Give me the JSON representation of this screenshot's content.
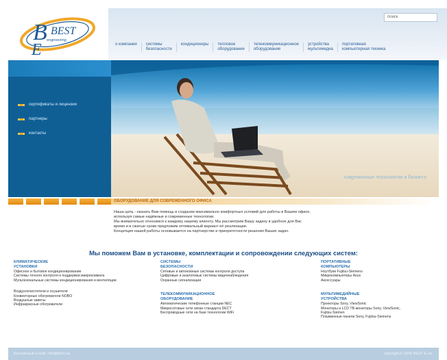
{
  "logo": {
    "text_top": "BEST",
    "text_sub": "engineering"
  },
  "search": {
    "placeholder": "поиск"
  },
  "nav": [
    {
      "label": "о компании"
    },
    {
      "label": "системы\nбезопасности"
    },
    {
      "label": "кондиционеры"
    },
    {
      "label": "тепловое\nоборудование"
    },
    {
      "label": "телекоммуникационное\nоборудование"
    },
    {
      "label": "устройства\nмультимедиа"
    },
    {
      "label": "портативная\nкомпьютерная техника"
    }
  ],
  "left_menu": [
    {
      "label": "сертификаты и лицензии"
    },
    {
      "label": "партнеры"
    },
    {
      "label": "контакты"
    }
  ],
  "hero": {
    "caption": "современные технологии в бизнесе"
  },
  "section": {
    "title": "ОБОРУДОВАНИЕ ДЛЯ СОВРЕМЕННОГО ОФИСА"
  },
  "intro": [
    "Наша цель - оказать Вам помощь в создании максимально комфортных условий для работы в Вашем офисе,",
    "используя самые надёжные и современные технологии.",
    "Мы внимательно относимся к каждому нашему клиенту. Мы рассмотрим Вашу задачу в удобное для Вас",
    "время и в сжатые сроки предложим оптимальный вариант её реализации.",
    "Концепция нашей работы основывается на партнерстве и приоритетности решения Ваших задач."
  ],
  "headline": "Мы поможем Вам в установке, комплектации и сопровождении следующих систем:",
  "columns": [
    {
      "blocks": [
        {
          "title": "КЛИМАТИЧЕСКИЕ\nУСТАНОВКИ",
          "items": [
            "Офисное и бытовое кондиционирование",
            "Системы точного контроля и поддержки микроклимата",
            "Мультизональные системы кондиционирования и вентиляции"
          ]
        },
        {
          "title": "",
          "items": [
            "Воздухоочистители и осушители",
            "Конвекторные обогреватели NOBO",
            "Воздушные завесы",
            "Инфракрасные обогреватели"
          ]
        }
      ]
    },
    {
      "blocks": [
        {
          "title": "СИСТЕМЫ\nБЕЗОПАСНОСТИ",
          "items": [
            "Сетевые и автономные системы контроля доступа",
            "Цифровые и аналоговые системы видеонаблюдения",
            "Охранные сигнализации"
          ]
        },
        {
          "title": "ТЕЛЕКОММУНИКАЦИОННОЕ\nОБОРУДОВАНИЕ",
          "items": [
            "Автоматические телефонные станции NEC",
            "Микросотовые сети связи стандарта DECT",
            "Беспроводные сети на базе технологии WiFi"
          ]
        }
      ]
    },
    {
      "blocks": [
        {
          "title": "ПОРТАТИВНЫЕ\nКОМПЬЮТЕРЫ",
          "items": [
            "Ноутбуки Fujitsu-Siemens",
            "Микрокомпьютеры Asus",
            "Аксессуары"
          ]
        },
        {
          "title": "МУЛЬТИМЕДИЙНЫЕ\nУСТРОЙСТВА",
          "items": [
            "Проекторы Sony, ViewSonic",
            "Мониторы и LCD TВ-мониторы Sony, ViewSonic,",
            "Fujitsu-Siemen",
            "Плазменные панели Sony, Fujitsu-Siemens"
          ]
        }
      ]
    }
  ],
  "footer": {
    "left": "Контактный e-mail: info@best.ua",
    "right": "copyright © 2005 BEST E.ua"
  },
  "colors": {
    "primary": "#0f5f95",
    "accent": "#e28a12",
    "heading": "#1c4f86"
  }
}
